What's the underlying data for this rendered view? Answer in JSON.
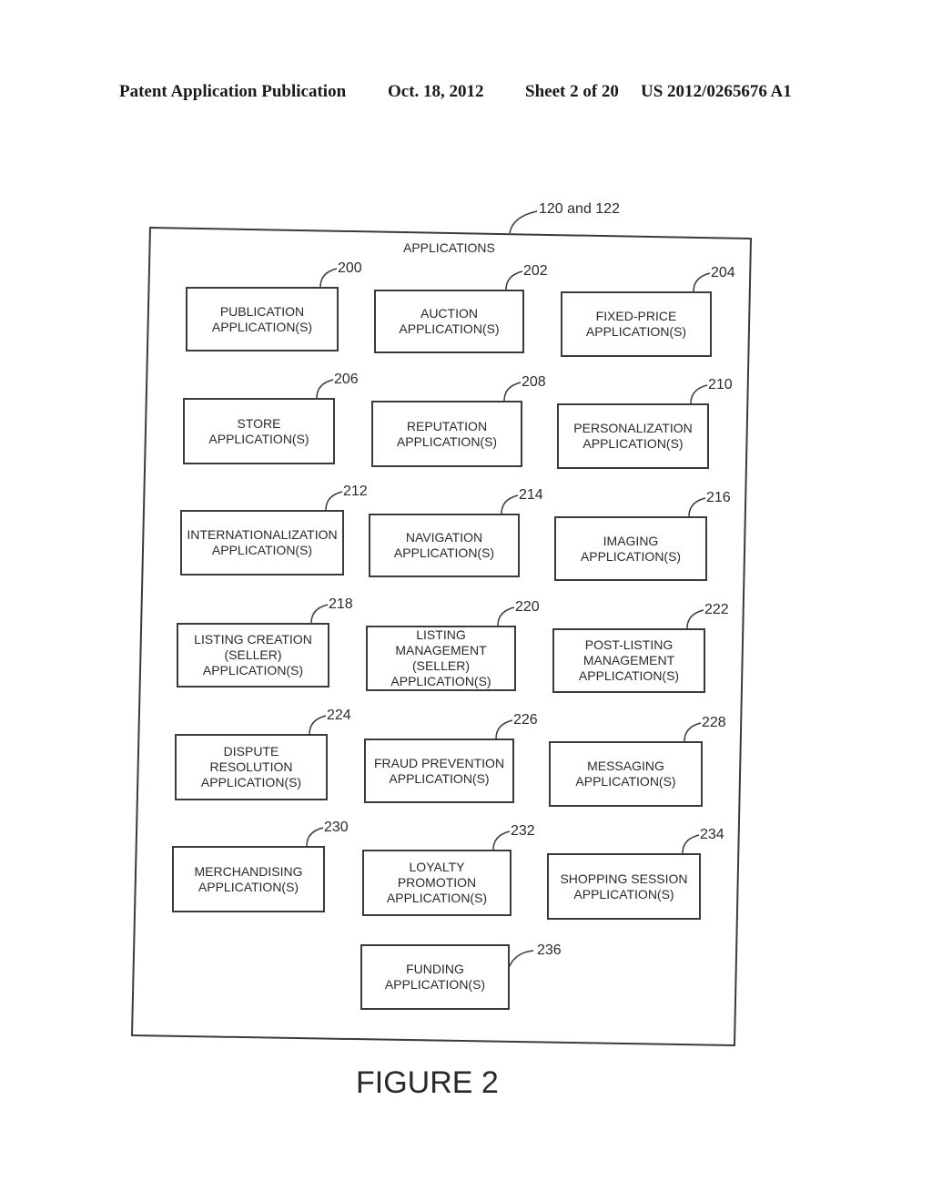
{
  "header": {
    "publication": "Patent Application Publication",
    "date": "Oct. 18, 2012",
    "sheet": "Sheet 2 of 20",
    "number": "US 2012/0265676 A1"
  },
  "diagram": {
    "outer_ref": "120 and 122",
    "outer_title": "APPLICATIONS",
    "boxes": [
      {
        "ref": "200",
        "label": "PUBLICATION\nAPPLICATION(S)"
      },
      {
        "ref": "202",
        "label": "AUCTION\nAPPLICATION(S)"
      },
      {
        "ref": "204",
        "label": "FIXED-PRICE\nAPPLICATION(S)"
      },
      {
        "ref": "206",
        "label": "STORE\nAPPLICATION(S)"
      },
      {
        "ref": "208",
        "label": "REPUTATION\nAPPLICATION(S)"
      },
      {
        "ref": "210",
        "label": "PERSONALIZATION\nAPPLICATION(S)"
      },
      {
        "ref": "212",
        "label": "INTERNATIONALIZATION\nAPPLICATION(S)"
      },
      {
        "ref": "214",
        "label": "NAVIGATION\nAPPLICATION(S)"
      },
      {
        "ref": "216",
        "label": "IMAGING\nAPPLICATION(S)"
      },
      {
        "ref": "218",
        "label": "LISTING CREATION\n(SELLER)\nAPPLICATION(S)"
      },
      {
        "ref": "220",
        "label": "LISTING\nMANAGEMENT\n(SELLER)\nAPPLICATION(S)"
      },
      {
        "ref": "222",
        "label": "POST-LISTING\nMANAGEMENT\nAPPLICATION(S)"
      },
      {
        "ref": "224",
        "label": "DISPUTE\nRESOLUTION\nAPPLICATION(S)"
      },
      {
        "ref": "226",
        "label": "FRAUD PREVENTION\nAPPLICATION(S)"
      },
      {
        "ref": "228",
        "label": "MESSAGING\nAPPLICATION(S)"
      },
      {
        "ref": "230",
        "label": "MERCHANDISING\nAPPLICATION(S)"
      },
      {
        "ref": "232",
        "label": "LOYALTY\nPROMOTION\nAPPLICATION(S)"
      },
      {
        "ref": "234",
        "label": "SHOPPING SESSION\nAPPLICATION(S)"
      },
      {
        "ref": "236",
        "label": "FUNDING\nAPPLICATION(S)"
      }
    ]
  },
  "caption": "FIGURE 2"
}
